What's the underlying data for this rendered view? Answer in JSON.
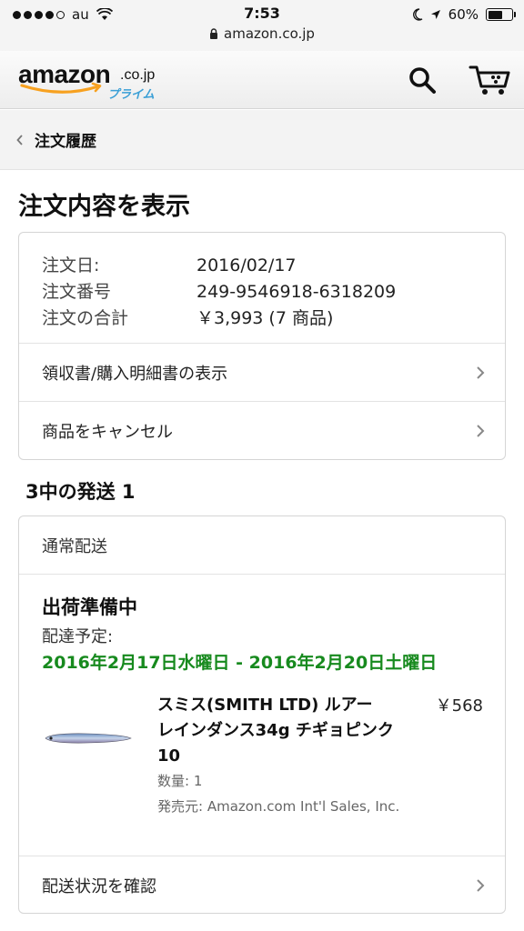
{
  "status_bar": {
    "carrier": "au",
    "time": "7:53",
    "battery": "60%",
    "url": "amazon.co.jp"
  },
  "header": {
    "logo_text": "amazon",
    "logo_tld": ".co.jp",
    "logo_sub": "プライム",
    "search_icon": "search-icon",
    "cart_icon": "cart-icon"
  },
  "breadcrumb": {
    "label": "注文履歴"
  },
  "page": {
    "title": "注文内容を表示"
  },
  "order": {
    "date_label": "注文日:",
    "date": "2016/02/17",
    "number_label": "注文番号",
    "number": "249-9546918-6318209",
    "total_label": "注文の合計",
    "total": "￥3,993 (7 商品)"
  },
  "actions": {
    "receipt": "領収書/購入明細書の表示",
    "cancel": "商品をキャンセル"
  },
  "shipments": {
    "title": "3中の発送 1",
    "type": "通常配送",
    "status": "出荷準備中",
    "eta_label": "配達予定:",
    "eta_range": "2016年2月17日水曜日 - 2016年2月20日土曜日",
    "track_label": "配送状況を確認"
  },
  "product": {
    "name": "スミス(SMITH LTD) ルアー レインダンス34g チギョピンク 10",
    "price": "￥568",
    "qty": "数量: 1",
    "seller": "発売元: Amazon.com Int'l Sales, Inc."
  },
  "colors": {
    "accent_green": "#178a1e",
    "logo_smile": "#f7a120",
    "prime_blue": "#3a9fd6"
  }
}
